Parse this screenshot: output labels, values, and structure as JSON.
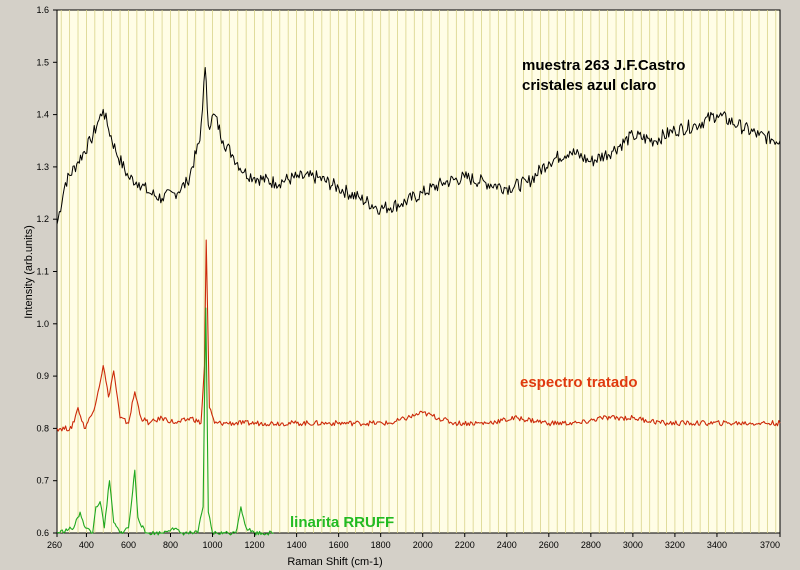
{
  "chart_data": {
    "type": "line",
    "xlabel": "Raman Shift (cm-1)",
    "ylabel": "Intensity (arb.units)",
    "xlim": [
      260,
      3700
    ],
    "ylim": [
      0.6,
      1.6
    ],
    "x_ticks": [
      260,
      400,
      600,
      800,
      1000,
      1200,
      1400,
      1600,
      1800,
      2000,
      2200,
      2400,
      2600,
      2800,
      3000,
      3200,
      3400,
      3700
    ],
    "y_ticks": [
      "0.6",
      "0.7",
      "0.8",
      "0.9",
      "1.0",
      "1.1",
      "1.2",
      "1.3",
      "1.4",
      "1.5",
      "1.6"
    ],
    "grid": "vertical",
    "background_color": "#fffde6",
    "grid_color": "#d9d38a",
    "annotations": [
      {
        "text": "muestra 263 J.F.Castro",
        "color": "#000000"
      },
      {
        "text": "cristales azul claro",
        "color": "#000000"
      },
      {
        "text": "espectro tratado",
        "color": "#e03a10"
      },
      {
        "text": "linarita RRUFF",
        "color": "#22bb22"
      }
    ],
    "series": [
      {
        "color": "#000000",
        "x": [
          260,
          300,
          360,
          420,
          460,
          480,
          500,
          540,
          600,
          650,
          700,
          760,
          820,
          880,
          940,
          965,
          980,
          1010,
          1050,
          1100,
          1150,
          1200,
          1300,
          1400,
          1500,
          1600,
          1700,
          1800,
          1900,
          2000,
          2100,
          2200,
          2300,
          2400,
          2500,
          2600,
          2700,
          2800,
          2900,
          3000,
          3100,
          3200,
          3300,
          3400,
          3500,
          3600,
          3700
        ],
        "y": [
          1.19,
          1.27,
          1.31,
          1.35,
          1.39,
          1.41,
          1.38,
          1.33,
          1.28,
          1.27,
          1.25,
          1.24,
          1.25,
          1.27,
          1.35,
          1.49,
          1.38,
          1.4,
          1.35,
          1.32,
          1.29,
          1.28,
          1.27,
          1.28,
          1.28,
          1.26,
          1.24,
          1.22,
          1.23,
          1.25,
          1.27,
          1.28,
          1.27,
          1.26,
          1.27,
          1.31,
          1.33,
          1.31,
          1.33,
          1.36,
          1.35,
          1.37,
          1.38,
          1.4,
          1.38,
          1.36,
          1.35
        ]
      },
      {
        "color": "#cc2a0a",
        "x": [
          260,
          330,
          360,
          390,
          430,
          455,
          480,
          505,
          530,
          560,
          600,
          630,
          660,
          700,
          760,
          830,
          900,
          945,
          962,
          970,
          985,
          1010,
          1060,
          1150,
          1250,
          1400,
          1550,
          1700,
          1850,
          2000,
          2150,
          2300,
          2450,
          2600,
          2750,
          2850,
          3000,
          3150,
          3300,
          3450,
          3600,
          3700
        ],
        "y": [
          0.8,
          0.8,
          0.84,
          0.8,
          0.83,
          0.87,
          0.92,
          0.86,
          0.91,
          0.82,
          0.81,
          0.87,
          0.82,
          0.81,
          0.82,
          0.81,
          0.82,
          0.81,
          0.92,
          1.16,
          0.84,
          0.81,
          0.81,
          0.81,
          0.81,
          0.81,
          0.81,
          0.81,
          0.81,
          0.83,
          0.81,
          0.81,
          0.82,
          0.81,
          0.81,
          0.82,
          0.82,
          0.81,
          0.81,
          0.81,
          0.81,
          0.81
        ]
      },
      {
        "color": "#1fa81f",
        "x": [
          260,
          340,
          370,
          395,
          430,
          445,
          465,
          485,
          510,
          530,
          560,
          600,
          615,
          630,
          645,
          680,
          760,
          810,
          850,
          930,
          955,
          968,
          980,
          1000,
          1060,
          1110,
          1135,
          1160,
          1200,
          1290
        ],
        "y": [
          0.6,
          0.61,
          0.64,
          0.61,
          0.6,
          0.65,
          0.66,
          0.61,
          0.7,
          0.62,
          0.6,
          0.61,
          0.66,
          0.72,
          0.63,
          0.6,
          0.6,
          0.61,
          0.6,
          0.6,
          0.65,
          1.03,
          0.64,
          0.6,
          0.6,
          0.6,
          0.65,
          0.61,
          0.6,
          0.6
        ]
      }
    ]
  }
}
